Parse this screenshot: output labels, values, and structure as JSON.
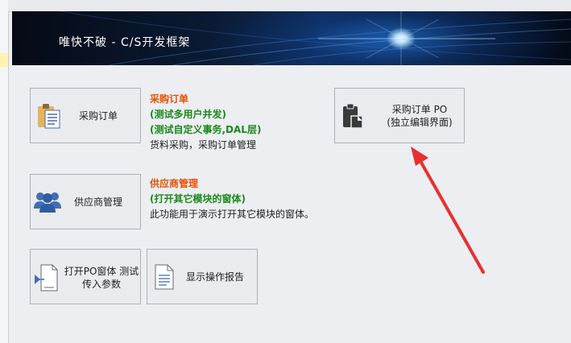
{
  "banner": {
    "title": "唯快不破 - C/S开发框架"
  },
  "tiles": {
    "purchase_order": "采购订单",
    "supplier_mgmt": "供应商管理",
    "open_po": "打开PO窗体 测试传入参数",
    "show_report": "显示操作报告",
    "po_standalone_line1": "采购订单 PO",
    "po_standalone_line2": "(独立编辑界面)"
  },
  "descriptions": {
    "purchase": {
      "title": "采购订单",
      "line1": "(测试多用户并发)",
      "line2": "(测试自定义事务,DAL层)",
      "line3": "货料采购，采购订单管理"
    },
    "supplier": {
      "title": "供应商管理",
      "line1": "(打开其它模块的窗体)",
      "line2": "此功能用于演示打开其它模块的窗体。"
    }
  },
  "colors": {
    "accent_title": "#e65100",
    "accent_green": "#1a8a1a",
    "arrow": "#e83030"
  },
  "icons": [
    "clipboard-icon",
    "users-icon",
    "open-form-icon",
    "document-icon",
    "clipboard-dark-icon"
  ]
}
